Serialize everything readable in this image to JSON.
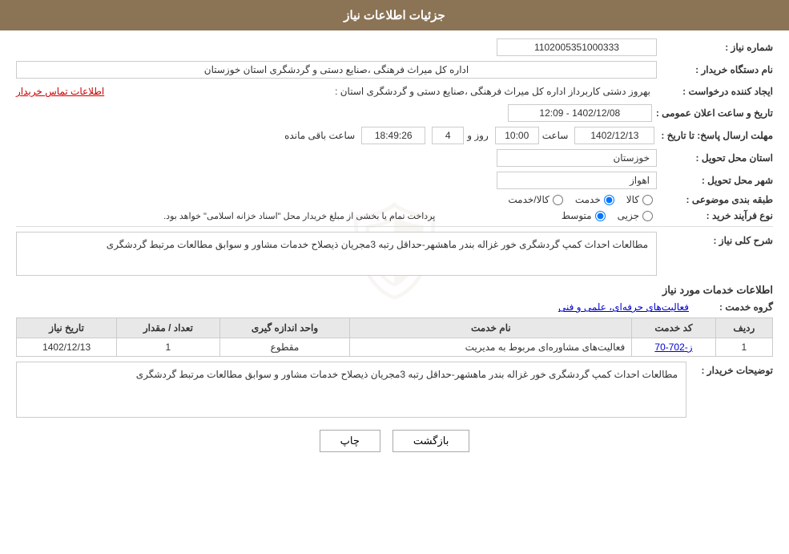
{
  "header": {
    "title": "جزئیات اطلاعات نیاز"
  },
  "fields": {
    "need_number_label": "شماره نیاز :",
    "need_number_value": "1102005351000333",
    "buyer_org_label": "نام دستگاه خریدار :",
    "buyer_org_value": "اداره کل میراث فرهنگی ،صنایع دستی و گردشگری استان خوزستان",
    "creator_label": "ایجاد کننده درخواست :",
    "creator_value": "بهروز دشتی کاربرداز اداره کل میراث فرهنگی ،صنایع دستی و گردشگری استان :",
    "contact_link": "اطلاعات تماس خریدار",
    "announce_label": "تاریخ و ساعت اعلان عمومی :",
    "announce_value": "1402/12/08 - 12:09",
    "deadline_label": "مهلت ارسال پاسخ: تا تاریخ :",
    "deadline_date": "1402/12/13",
    "deadline_time_label": "ساعت",
    "deadline_time": "10:00",
    "deadline_day_label": "روز و",
    "deadline_days": "4",
    "remaining_label": "ساعت باقی مانده",
    "remaining_value": "18:49:26",
    "province_label": "استان محل تحویل :",
    "province_value": "خوزستان",
    "city_label": "شهر محل تحویل :",
    "city_value": "اهواز",
    "category_label": "طبقه بندی موضوعی :",
    "category_options": [
      {
        "id": "kala",
        "label": "کالا",
        "checked": false
      },
      {
        "id": "khadamat",
        "label": "خدمت",
        "checked": true
      },
      {
        "id": "kala_khadamat",
        "label": "کالا/خدمت",
        "checked": false
      }
    ],
    "purchase_type_label": "نوع فرآیند خرید :",
    "purchase_type_options": [
      {
        "id": "jozi",
        "label": "جزیی",
        "checked": false
      },
      {
        "id": "motavasset",
        "label": "متوسط",
        "checked": true
      }
    ],
    "purchase_note": "پرداخت تمام یا بخشی از مبلغ خریدار محل \"اسناد خزانه اسلامی\" خواهد بود.",
    "description_label": "شرح کلی نیاز :",
    "description_value": "مطالعات احداث کمپ گردشگری خور غزاله بندر ماهشهر-حداقل رتبه 3مجریان ذیصلاح خدمات مشاور و سوابق مطالعات مرتبط گردشگری",
    "service_info_title": "اطلاعات خدمات مورد نیاز",
    "service_group_label": "گروه خدمت :",
    "service_group_value": "فعالیت‌های حرفه‌ای، علمی و فنی",
    "table_headers": {
      "row_num": "ردیف",
      "service_code": "کد خدمت",
      "service_name": "نام خدمت",
      "unit": "واحد اندازه گیری",
      "quantity": "تعداد / مقدار",
      "date": "تاریخ نیاز"
    },
    "table_rows": [
      {
        "row_num": "1",
        "service_code": "ز-702-70",
        "service_name": "فعالیت‌های مشاوره‌ای مربوط به مدیریت",
        "unit": "مقطوع",
        "quantity": "1",
        "date": "1402/12/13"
      }
    ],
    "buyer_desc_label": "توضیحات خریدار :",
    "buyer_desc_value": "مطالعات احداث کمپ گردشگری خور غزاله بندر ماهشهر-حداقل رتبه 3مجریان ذیصلاح خدمات مشاور و سوابق مطالعات مرتبط گردشگری"
  },
  "buttons": {
    "print_label": "چاپ",
    "back_label": "بازگشت"
  }
}
